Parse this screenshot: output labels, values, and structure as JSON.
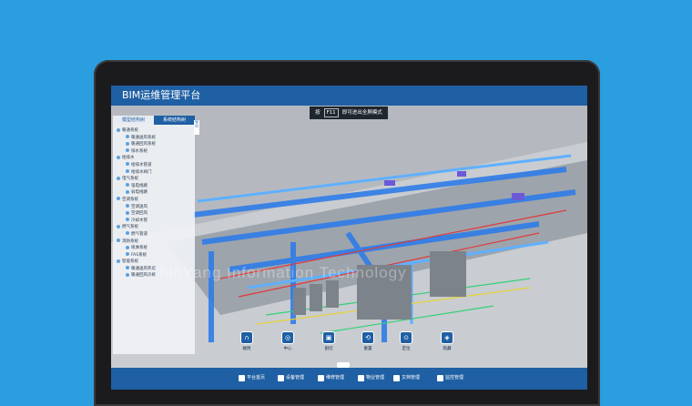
{
  "app": {
    "title": "BIM运维管理平台"
  },
  "hint": {
    "prefix": "按",
    "key": "F11",
    "suffix": "即可进出全屏模式"
  },
  "panel": {
    "tabs": [
      "模型结构树",
      "系统结构树"
    ],
    "side_tab": "导出",
    "tree": [
      {
        "label": "暖通系统",
        "level": 0
      },
      {
        "label": "暖通送风系统",
        "level": 1
      },
      {
        "label": "暖通回风系统",
        "level": 1
      },
      {
        "label": "排水系统",
        "level": 1
      },
      {
        "label": "给排水",
        "level": 0
      },
      {
        "label": "给排水管道",
        "level": 1
      },
      {
        "label": "给排水阀门",
        "level": 1
      },
      {
        "label": "电气系统",
        "level": 0
      },
      {
        "label": "强电线路",
        "level": 1
      },
      {
        "label": "弱电线路",
        "level": 1
      },
      {
        "label": "空调系统",
        "level": 0
      },
      {
        "label": "空调送风",
        "level": 1
      },
      {
        "label": "空调回风",
        "level": 1
      },
      {
        "label": "冷却水管",
        "level": 1
      },
      {
        "label": "燃气系统",
        "level": 0
      },
      {
        "label": "燃气管道",
        "level": 1
      },
      {
        "label": "消防系统",
        "level": 0
      },
      {
        "label": "喷淋系统",
        "level": 1
      },
      {
        "label": "FAS系统",
        "level": 1
      },
      {
        "label": "智能系统",
        "level": 0
      },
      {
        "label": "暖通送风系统",
        "level": 1
      },
      {
        "label": "暖通回风系统",
        "level": 1
      }
    ]
  },
  "toolbar": [
    {
      "icon": "magnet-icon",
      "glyph": "∩",
      "label": "磁附"
    },
    {
      "icon": "target-icon",
      "glyph": "◎",
      "label": "中心"
    },
    {
      "icon": "box-icon",
      "glyph": "▣",
      "label": "剖切"
    },
    {
      "icon": "reset-icon",
      "glyph": "⟲",
      "label": "重置"
    },
    {
      "icon": "locate-icon",
      "glyph": "⊙",
      "label": "定位"
    },
    {
      "icon": "shield-icon",
      "glyph": "◈",
      "label": "隐藏"
    }
  ],
  "bottom": [
    {
      "icon": "home-icon",
      "label": "平台首页"
    },
    {
      "icon": "device-icon",
      "label": "设备管理"
    },
    {
      "icon": "wrench-icon",
      "label": "维修管理"
    },
    {
      "icon": "building-icon",
      "label": "物业管理"
    },
    {
      "icon": "document-icon",
      "label": "文档管理"
    },
    {
      "icon": "monitor-icon",
      "label": "监控管理"
    }
  ],
  "watermark": "ChinYang Information Technology",
  "colors": {
    "background": "#2b9ee0",
    "brand": "#1f5fa3"
  }
}
